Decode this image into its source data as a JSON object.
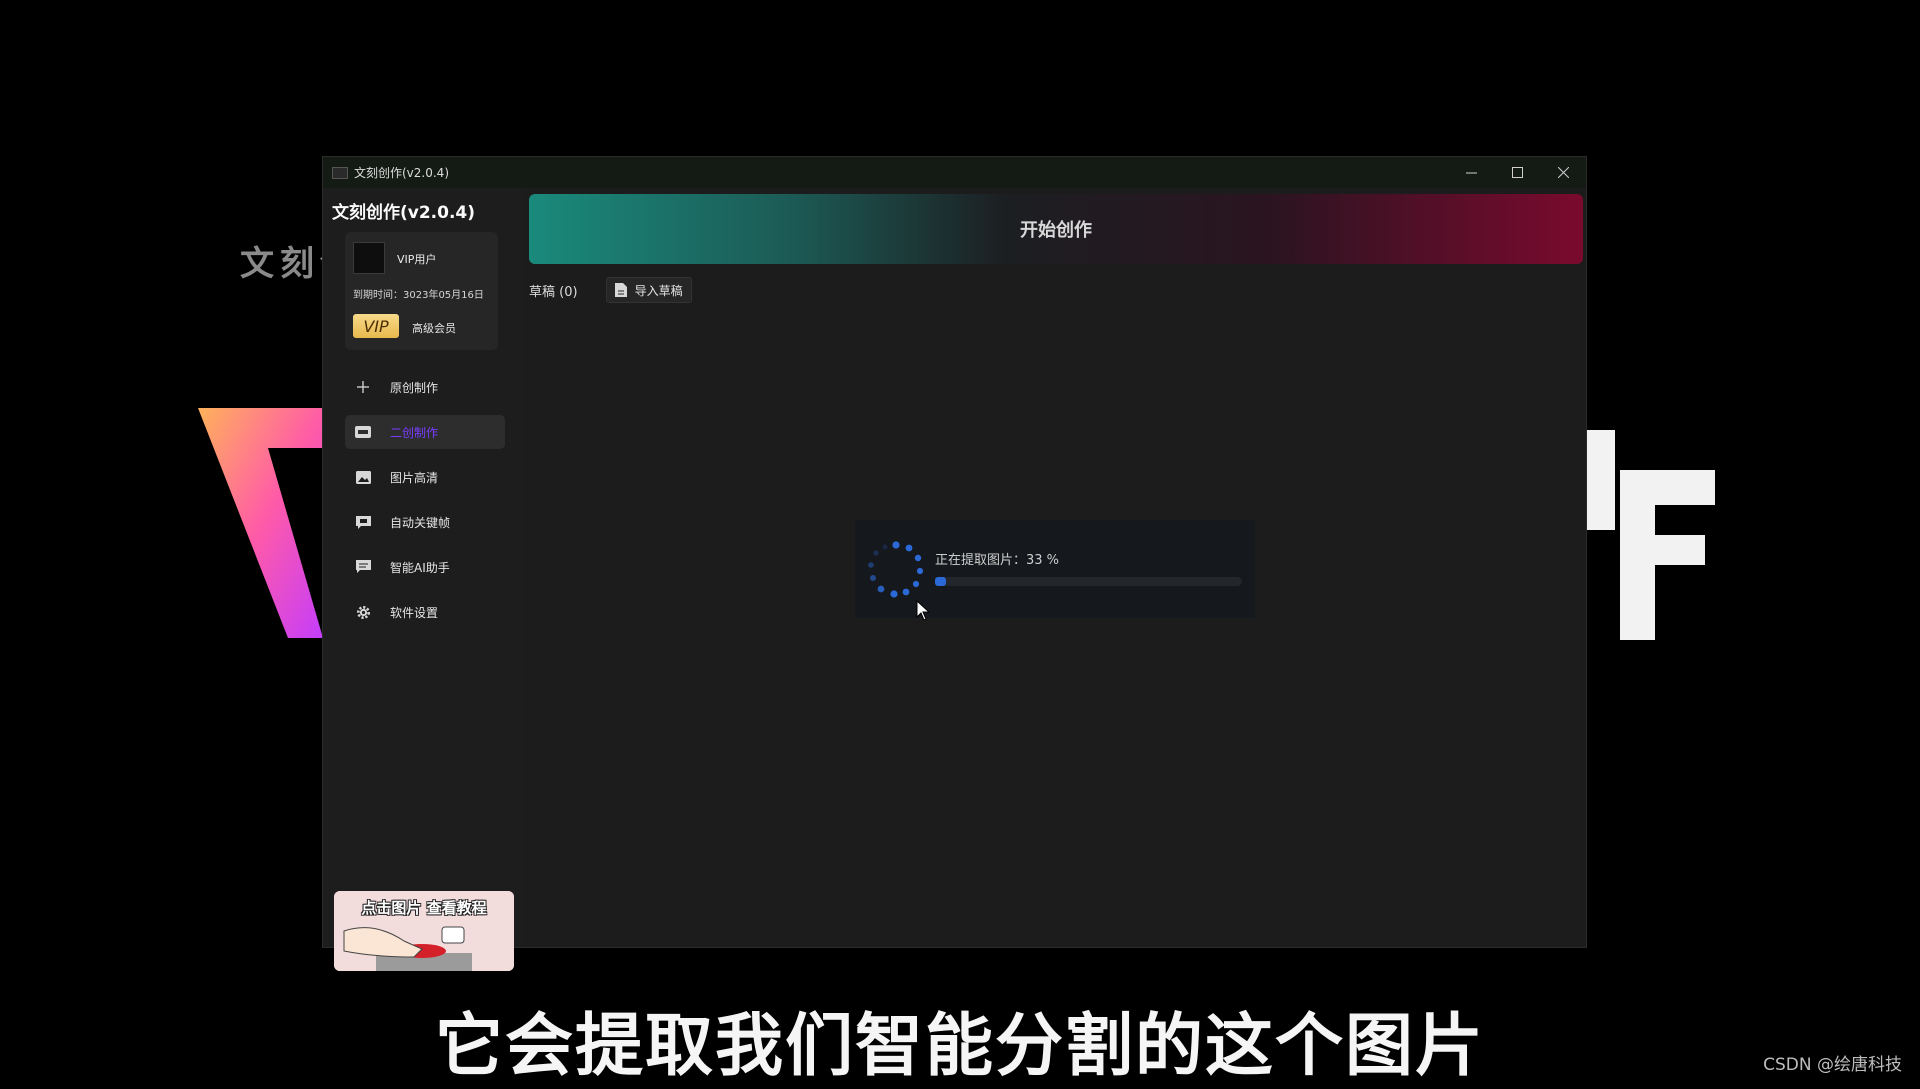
{
  "background": {
    "watermark": "文刻创作",
    "subtitle": "它会提取我们智能分割的这个图片",
    "credit": "CSDN @绘唐科技"
  },
  "window": {
    "title": "文刻创作(v2.0.4)",
    "controls": [
      "minimize",
      "maximize",
      "close"
    ]
  },
  "sidebar": {
    "title": "文刻创作(v2.0.4)",
    "user": {
      "name": "VIP用户",
      "expire": "到期时间：3023年05月16日",
      "vip_badge": "VIP",
      "level": "高级会员"
    },
    "nav": [
      {
        "label": "原创制作",
        "icon": "plus-icon",
        "active": false
      },
      {
        "label": "二创制作",
        "icon": "video-icon",
        "active": true
      },
      {
        "label": "图片高清",
        "icon": "image-icon",
        "active": false
      },
      {
        "label": "自动关键帧",
        "icon": "keyframe-icon",
        "active": false
      },
      {
        "label": "智能AI助手",
        "icon": "chat-icon",
        "active": false
      },
      {
        "label": "软件设置",
        "icon": "gear-icon",
        "active": false
      }
    ],
    "tutorial": "点击图片 查看教程"
  },
  "main": {
    "banner": "开始创作",
    "drafts_label": "草稿 (0)",
    "import_label": "导入草稿"
  },
  "progress": {
    "text": "正在提取图片：33 %",
    "percent": 33,
    "accent": "#2b6ad6"
  }
}
